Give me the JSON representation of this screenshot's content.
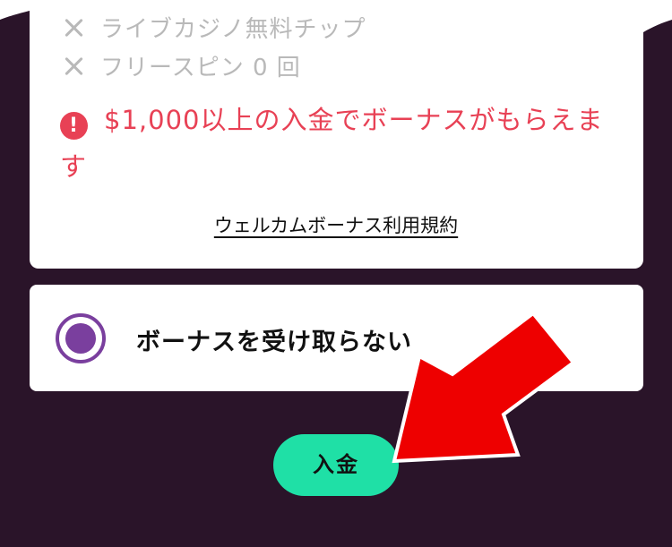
{
  "colors": {
    "background": "#2a1429",
    "card": "#ffffff",
    "excluded_text": "#b9b9b9",
    "notice_red": "#e84155",
    "radio_purple": "#7a3f9e",
    "button_green": "#1fe0a6",
    "arrow_red": "#ee0000"
  },
  "bonus_card": {
    "excluded_items": [
      {
        "icon": "x-icon",
        "label": "ライブカジノ無料チップ"
      },
      {
        "icon": "x-icon",
        "label": "フリースピン 0 回"
      }
    ],
    "notice": {
      "icon": "exclamation-icon",
      "icon_glyph": "!",
      "text": "$1,000以上の入金でボーナスがもらえます"
    },
    "terms_link": "ウェルカムボーナス利用規約"
  },
  "bonus_option": {
    "selected": true,
    "label": "ボーナスを受け取らない"
  },
  "deposit_button": {
    "label": "入金"
  },
  "annotation": {
    "icon": "red-arrow-icon"
  }
}
